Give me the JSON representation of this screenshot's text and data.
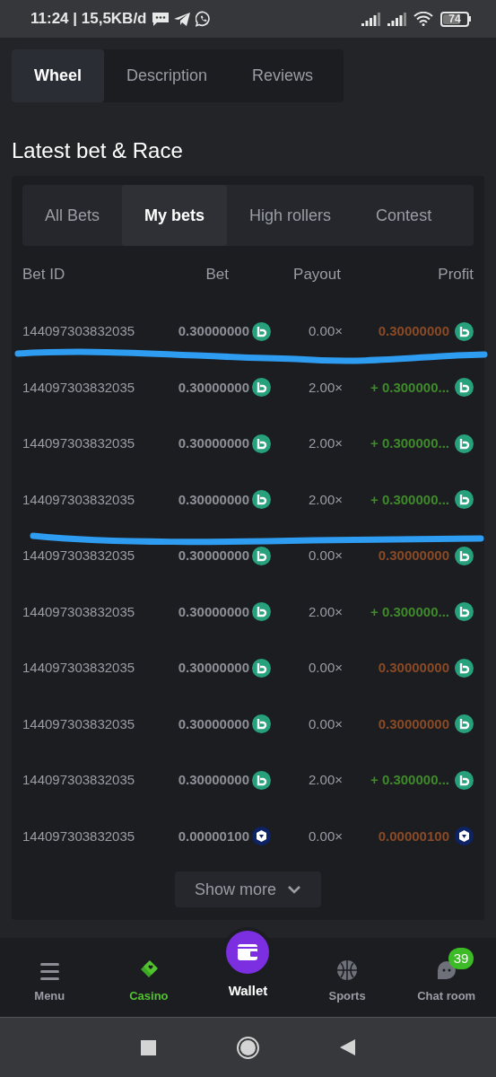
{
  "status_bar": {
    "time": "11:24 | 15,5KB/d",
    "battery": "74"
  },
  "game_tabs": [
    {
      "label": "Wheel",
      "selected": true
    },
    {
      "label": "Description",
      "selected": false
    },
    {
      "label": "Reviews",
      "selected": false
    }
  ],
  "section_title": "Latest bet & Race",
  "bet_tabs": [
    {
      "label": "All Bets",
      "selected": false
    },
    {
      "label": "My bets",
      "selected": true
    },
    {
      "label": "High rollers",
      "selected": false
    },
    {
      "label": "Contest",
      "selected": false
    }
  ],
  "table": {
    "columns": [
      "Bet ID",
      "Bet",
      "Payout",
      "Profit"
    ],
    "rows": [
      {
        "bet_id": "144097303832035",
        "bet": {
          "text": "**0.3**0000000",
          "kind": "bc"
        },
        "payout": "0.00×",
        "profit": {
          "text": "**0.3**0000000",
          "kind": "loss"
        }
      },
      {
        "bet_id": "144097303832035",
        "bet": {
          "text": "**0.3**0000000",
          "kind": "bc"
        },
        "payout": "2.00×",
        "profit": {
          "text": "+ **0.3**00000...",
          "kind": "win"
        }
      },
      {
        "bet_id": "144097303832035",
        "bet": {
          "text": "**0.3**0000000",
          "kind": "bc"
        },
        "payout": "2.00×",
        "profit": {
          "text": "+ **0.3**00000...",
          "kind": "win"
        }
      },
      {
        "bet_id": "144097303832035",
        "bet": {
          "text": "**0.3**0000000",
          "kind": "bc"
        },
        "payout": "2.00×",
        "profit": {
          "text": "+ **0.3**00000...",
          "kind": "win"
        }
      },
      {
        "bet_id": "144097303832035",
        "bet": {
          "text": "**0.3**0000000",
          "kind": "bc"
        },
        "payout": "0.00×",
        "profit": {
          "text": "**0.3**0000000",
          "kind": "loss"
        }
      },
      {
        "bet_id": "144097303832035",
        "bet": {
          "text": "**0.3**0000000",
          "kind": "bc"
        },
        "payout": "2.00×",
        "profit": {
          "text": "+ **0.3**00000...",
          "kind": "win"
        }
      },
      {
        "bet_id": "144097303832035",
        "bet": {
          "text": "**0.3**0000000",
          "kind": "bc"
        },
        "payout": "0.00×",
        "profit": {
          "text": "**0.3**0000000",
          "kind": "loss"
        }
      },
      {
        "bet_id": "144097303832035",
        "bet": {
          "text": "**0.3**0000000",
          "kind": "bc"
        },
        "payout": "0.00×",
        "profit": {
          "text": "**0.3**0000000",
          "kind": "loss"
        }
      },
      {
        "bet_id": "144097303832035",
        "bet": {
          "text": "**0.3**0000000",
          "kind": "bc"
        },
        "payout": "2.00×",
        "profit": {
          "text": "+ **0.3**00000...",
          "kind": "win"
        }
      },
      {
        "bet_id": "144097303832035",
        "bet": {
          "text": "**0.000001**00",
          "kind": "cro"
        },
        "payout": "0.00×",
        "profit": {
          "text": "**0.000001**00",
          "kind": "loss"
        }
      }
    ]
  },
  "show_more": "Show more",
  "bottom_nav": [
    {
      "label": "Menu",
      "kind": "menu",
      "selected": false
    },
    {
      "label": "Casino",
      "kind": "cards",
      "selected": true
    },
    {
      "label": "Wallet",
      "kind": "wallet",
      "selected": false
    },
    {
      "label": "Sports",
      "kind": "ball",
      "selected": false
    },
    {
      "label": "Chat room",
      "kind": "chat",
      "selected": false,
      "badge": "39"
    }
  ]
}
